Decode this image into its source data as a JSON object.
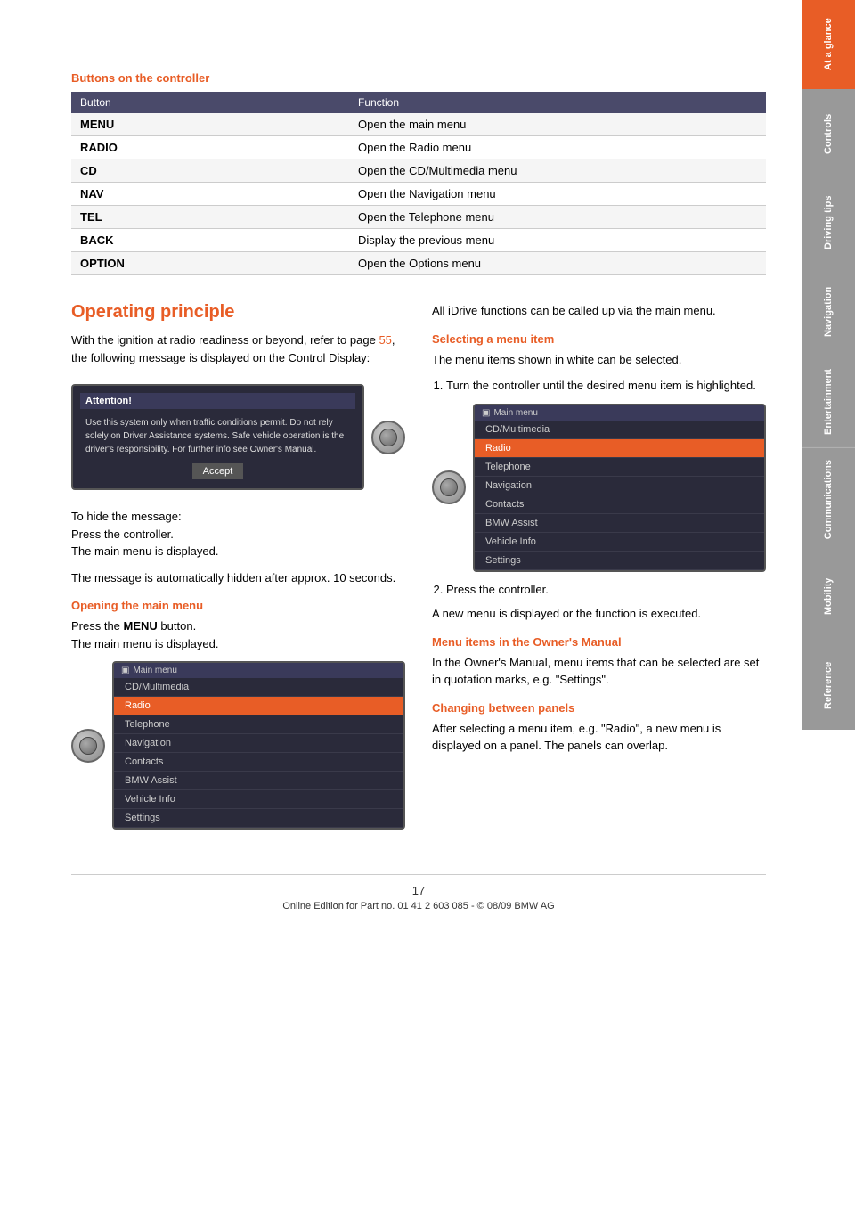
{
  "page": {
    "number": "17",
    "footer_text": "Online Edition for Part no. 01 41 2 603 085 - © 08/09 BMW AG"
  },
  "sidebar": {
    "tabs": [
      {
        "id": "at-a-glance",
        "label": "At a glance",
        "active": true
      },
      {
        "id": "controls",
        "label": "Controls",
        "active": false
      },
      {
        "id": "driving-tips",
        "label": "Driving tips",
        "active": false
      },
      {
        "id": "navigation",
        "label": "Navigation",
        "active": false
      },
      {
        "id": "entertainment",
        "label": "Entertainment",
        "active": false
      },
      {
        "id": "communications",
        "label": "Communications",
        "active": false
      },
      {
        "id": "mobility",
        "label": "Mobility",
        "active": false
      },
      {
        "id": "reference",
        "label": "Reference",
        "active": false
      }
    ]
  },
  "buttons_section": {
    "title": "Buttons on the controller",
    "table": {
      "header": [
        "Button",
        "Function"
      ],
      "rows": [
        [
          "MENU",
          "Open the main menu"
        ],
        [
          "RADIO",
          "Open the Radio menu"
        ],
        [
          "CD",
          "Open the CD/Multimedia menu"
        ],
        [
          "NAV",
          "Open the Navigation menu"
        ],
        [
          "TEL",
          "Open the Telephone menu"
        ],
        [
          "BACK",
          "Display the previous menu"
        ],
        [
          "OPTION",
          "Open the Options menu"
        ]
      ]
    }
  },
  "operating_principle": {
    "title": "Operating principle",
    "intro": "With the ignition at radio readiness or beyond, refer to page 55, the following message is displayed on the Control Display:",
    "intro_link": "55",
    "attention_box": {
      "header": "Attention!",
      "body": "Use this system only when traffic conditions permit. Do not rely solely on Driver Assistance systems. Safe vehicle operation is the driver's responsibility. For further info see Owner's Manual.",
      "accept_button": "Accept"
    },
    "hide_message_text": "To hide the message:\nPress the controller.\nThe main menu is displayed.",
    "auto_hide_text": "The message is automatically hidden after approx. 10 seconds.",
    "opening_main_menu": {
      "subtitle": "Opening the main menu",
      "text": "Press the MENU button.\nThe main menu is displayed.",
      "bold_word": "MENU"
    },
    "main_menu_items_left": [
      "CD/Multimedia",
      "Radio",
      "Telephone",
      "Navigation",
      "Contacts",
      "BMW Assist",
      "Vehicle Info",
      "Settings"
    ],
    "selected_item_left": "Radio",
    "all_idrive_text": "All iDrive functions can be called up via the main menu.",
    "selecting_menu_item": {
      "subtitle": "Selecting a menu item",
      "text": "The menu items shown in white can be selected.",
      "step1": "Turn the controller until the desired menu item is highlighted.",
      "step2": "Press the controller.",
      "step2_result": "A new menu is displayed or the function is executed."
    },
    "main_menu_items_right": [
      "CD/Multimedia",
      "Radio",
      "Telephone",
      "Navigation",
      "Contacts",
      "BMW Assist",
      "Vehicle Info",
      "Settings"
    ],
    "selected_item_right": "Radio",
    "menu_owners_manual": {
      "subtitle": "Menu items in the Owner's Manual",
      "text": "In the Owner's Manual, menu items that can be selected are set in quotation marks, e.g. \"Settings\"."
    },
    "changing_between_panels": {
      "subtitle": "Changing between panels",
      "text": "After selecting a menu item, e.g. \"Radio\", a new menu is displayed on a panel. The panels can overlap."
    }
  }
}
